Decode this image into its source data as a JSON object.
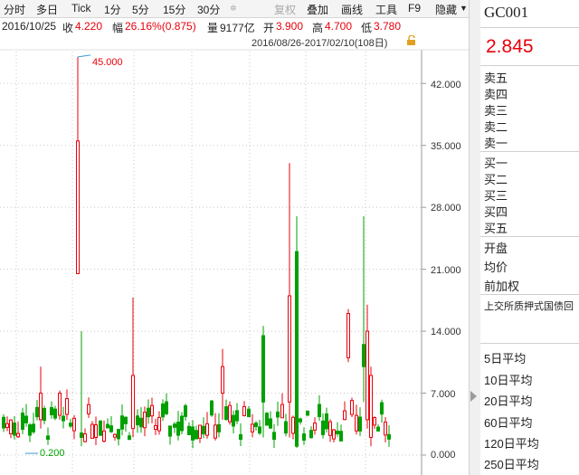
{
  "toolbar": {
    "items": [
      "分时",
      "多日",
      "Tick",
      "1分",
      "5分",
      "15分",
      "30分",
      "复权",
      "叠加",
      "画线",
      "工具",
      "F9",
      "隐藏"
    ]
  },
  "info": {
    "date": "2016/10/25",
    "close_label": "收",
    "close_value": "4.220",
    "change_label": "幅",
    "change_value": "26.16%(0.875)",
    "volume_label": "量",
    "volume_value": "9177亿",
    "open_label": "开",
    "open_value": "3.900",
    "high_label": "高",
    "high_value": "4.700",
    "low_label": "低",
    "low_value": "3.780"
  },
  "chart": {
    "range_label": "2016/08/26-2017/02/10(108日)",
    "max_annotation": "45.000",
    "min_annotation": "0.200",
    "y_ticks": [
      "42.000",
      "35.000",
      "28.000",
      "21.000",
      "14.000",
      "7.000",
      "0.000"
    ]
  },
  "chart_data": {
    "type": "candlestick",
    "x_range": [
      "2016/08/26",
      "2017/02/10"
    ],
    "ylim": [
      0,
      45
    ],
    "y_tick_values": [
      0,
      7,
      14,
      21,
      28,
      35,
      42
    ],
    "annotated_max": 45.0,
    "annotated_min": 0.2,
    "up_color": "#e8000b",
    "down_color": "#00a000",
    "grid": true
  },
  "panel": {
    "code": "GC001",
    "price": "2.845",
    "sell_rows": [
      "卖五",
      "卖四",
      "卖三",
      "卖二",
      "卖一"
    ],
    "buy_rows": [
      "买一",
      "买二",
      "买三",
      "买四",
      "买五"
    ],
    "stat_rows": [
      "开盘",
      "均价",
      "前加权"
    ],
    "description": "上交所质押式国债回",
    "ma_rows": [
      "5日平均",
      "10日平均",
      "20日平均",
      "60日平均",
      "120日平均",
      "250日平均"
    ]
  }
}
